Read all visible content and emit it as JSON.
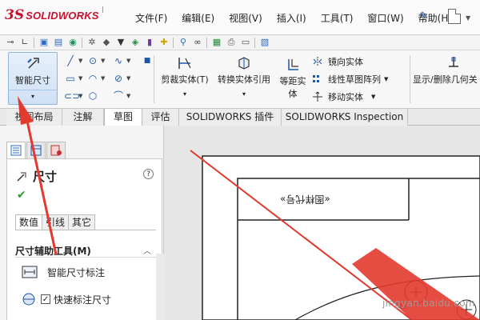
{
  "app": {
    "logo_mark": "3S",
    "logo_text": "SOLIDWORKS"
  },
  "menu": [
    "文件(F)",
    "编辑(E)",
    "视图(V)",
    "插入(I)",
    "工具(T)",
    "窗口(W)",
    "帮助(H)"
  ],
  "ribbon": {
    "smart_dimension": "智能尺寸",
    "trim": "剪裁实体(T)",
    "convert": "转换实体引用",
    "offset_line1": "等距实",
    "offset_line2": "体",
    "mirror": "镜向实体",
    "linear_pattern": "线性草图阵列",
    "move": "移动实体",
    "show_hide": "显示/删除几何关"
  },
  "tabs": [
    "视图布局",
    "注解",
    "草图",
    "评估",
    "SOLIDWORKS 插件",
    "SOLIDWORKS Inspection"
  ],
  "active_tab": "草图",
  "property_manager": {
    "title": "尺寸",
    "help": "?",
    "subtabs": [
      "数值",
      "引线",
      "其它"
    ],
    "group_title": "尺寸辅助工具(M)",
    "options": {
      "smart_dim": "智能尺寸标注",
      "quick_dim": "快速标注尺寸"
    }
  },
  "canvas": {
    "title_cell_text": "«图样代号»"
  },
  "watermark": "jingyan.baidu.com",
  "colors": {
    "brand": "#c8102e",
    "annotation_arrow": "#e23a2e",
    "sketch_blue": "#1d56a6",
    "ok_green": "#2a9b2a"
  }
}
